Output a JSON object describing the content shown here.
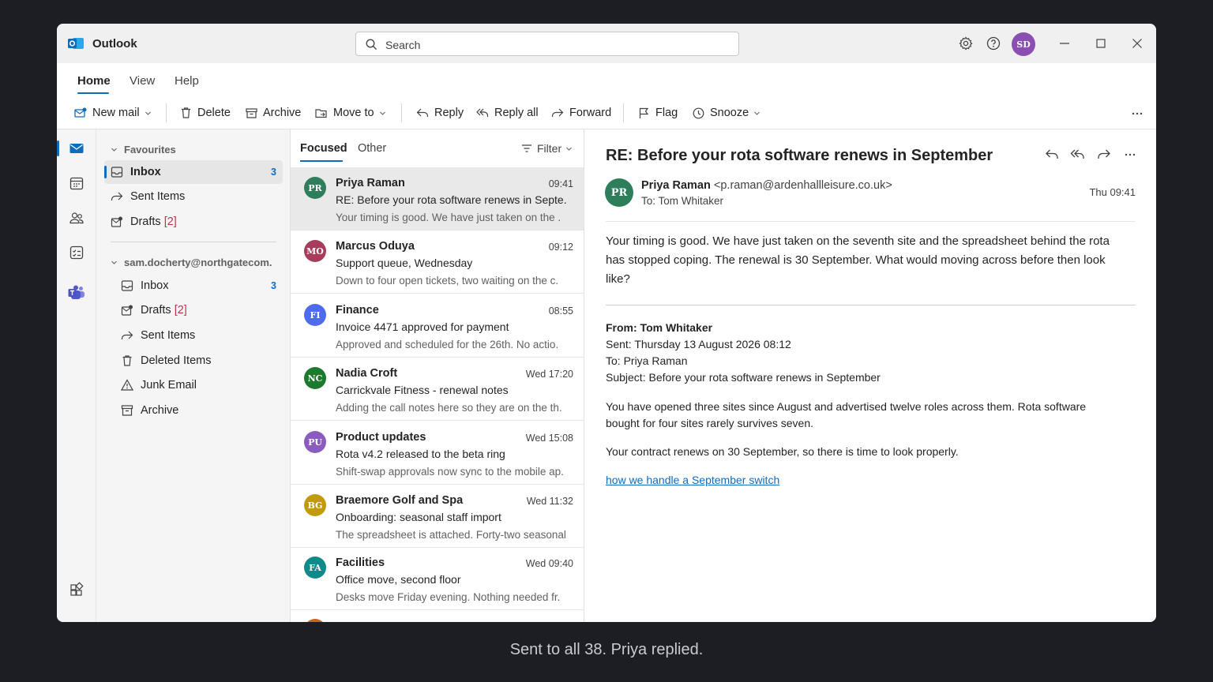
{
  "app": {
    "name": "Outlook"
  },
  "search": {
    "placeholder": "Search"
  },
  "user": {
    "initials": "SD"
  },
  "ribbon": {
    "tabs": [
      "Home",
      "View",
      "Help"
    ],
    "commands": {
      "new_mail": "New mail",
      "delete": "Delete",
      "archive": "Archive",
      "move_to": "Move to",
      "reply": "Reply",
      "reply_all": "Reply all",
      "forward": "Forward",
      "flag": "Flag",
      "snooze": "Snooze"
    }
  },
  "folders": {
    "favourites_label": "Favourites",
    "favourites": [
      {
        "label": "Inbox",
        "count": "3",
        "icon": "inbox-icon"
      },
      {
        "label": "Sent Items",
        "icon": "sent-icon"
      },
      {
        "label": "Drafts",
        "count_text": "[2]",
        "icon": "drafts-icon"
      }
    ],
    "account_label": "sam.docherty@northgatecom.",
    "account": [
      {
        "label": "Inbox",
        "count": "3",
        "icon": "inbox-icon"
      },
      {
        "label": "Drafts",
        "count_text": "[2]",
        "icon": "drafts-icon"
      },
      {
        "label": "Sent Items",
        "icon": "sent-icon"
      },
      {
        "label": "Deleted Items",
        "icon": "trash-icon"
      },
      {
        "label": "Junk Email",
        "icon": "warning-icon"
      },
      {
        "label": "Archive",
        "icon": "archive-icon"
      }
    ]
  },
  "message_list": {
    "tabs": [
      "Focused",
      "Other"
    ],
    "filter_label": "Filter",
    "messages": [
      {
        "initials": "PR",
        "color": "#2e7d5b",
        "from": "Priya Raman",
        "time": "09:41",
        "subject": "RE: Before your rota software renews in Septe.",
        "preview": "Your timing is good. We have just taken on the ."
      },
      {
        "initials": "MO",
        "color": "#a63d5c",
        "from": "Marcus Oduya",
        "time": "09:12",
        "subject": "Support queue, Wednesday",
        "preview": "Down to four open tickets, two waiting on the c."
      },
      {
        "initials": "FI",
        "color": "#4f6bed",
        "from": "Finance",
        "time": "08:55",
        "subject": "Invoice 4471 approved for payment",
        "preview": "Approved and scheduled for the 26th. No actio."
      },
      {
        "initials": "NC",
        "color": "#1b7a2e",
        "from": "Nadia Croft",
        "time": "Wed 17:20",
        "subject": "Carrickvale Fitness - renewal notes",
        "preview": "Adding the call notes here so they are on the th."
      },
      {
        "initials": "PU",
        "color": "#8a5cc0",
        "from": "Product updates",
        "time": "Wed 15:08",
        "subject": "Rota v4.2 released to the beta ring",
        "preview": "Shift-swap approvals now sync to the mobile ap."
      },
      {
        "initials": "BG",
        "color": "#c29a0a",
        "from": "Braemore Golf and Spa",
        "time": "Wed 11:32",
        "subject": "Onboarding: seasonal staff import",
        "preview": "The spreadsheet is attached. Forty-two seasonal."
      },
      {
        "initials": "FA",
        "color": "#0e8a8a",
        "from": "Facilities",
        "time": "Wed 09:40",
        "subject": "Office move, second floor",
        "preview": "Desks move Friday evening. Nothing needed fr."
      }
    ]
  },
  "reading": {
    "subject": "RE: Before your rota software renews in September",
    "sender_initials": "PR",
    "sender_name": "Priya Raman",
    "sender_email": "<p.raman@ardenhallleisure.co.uk>",
    "to": "To: Tom Whitaker",
    "date": "Thu 09:41",
    "body": "Your timing is good. We have just taken on the seventh site and the spreadsheet behind the rota has stopped coping. The renewal is 30 September. What would moving across before then look like?",
    "quoted": {
      "from": "From: Tom Whitaker",
      "sent": "Sent: Thursday 13 August 2026 08:12",
      "to": "To: Priya Raman",
      "subject": "Subject: Before your rota software renews in September",
      "para1": "You have opened three sites since August and advertised twelve roles across them. Rota software bought for four sites rarely survives seven.",
      "para2": "Your contract renews on 30 September, so there is time to look properly.",
      "link": "how we handle a September switch"
    }
  },
  "caption": "Sent to all 38. Priya replied."
}
